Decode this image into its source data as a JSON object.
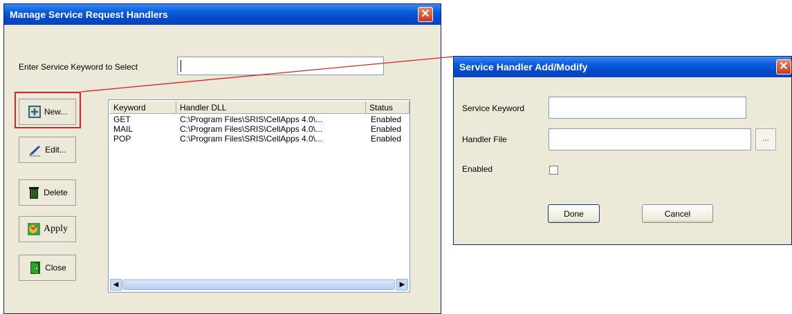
{
  "manage_window": {
    "title": "Manage Service Request Handlers",
    "keyword_label": "Enter Service Keyword to Select",
    "keyword_value": "",
    "buttons": {
      "new_label": "New...",
      "edit_label": "Edit...",
      "delete_label": "Delete",
      "apply_label": "Apply",
      "close_label": "Close"
    },
    "list": {
      "columns": [
        "Keyword",
        "Handler DLL",
        "Status"
      ],
      "rows": [
        {
          "keyword": "GET",
          "dll": "C:\\Program Files\\SRIS\\CellApps 4.0\\...",
          "status": "Enabled"
        },
        {
          "keyword": "MAIL",
          "dll": "C:\\Program Files\\SRIS\\CellApps 4.0\\...",
          "status": "Enabled"
        },
        {
          "keyword": "POP",
          "dll": "C:\\Program Files\\SRIS\\CellApps 4.0\\...",
          "status": "Enabled"
        }
      ]
    }
  },
  "modify_window": {
    "title": "Service Handler Add/Modify",
    "service_keyword_label": "Service Keyword",
    "service_keyword_value": "",
    "handler_file_label": "Handler File",
    "handler_file_value": "",
    "browse_label": "...",
    "enabled_label": "Enabled",
    "enabled_checked": false,
    "done_label": "Done",
    "cancel_label": "Cancel"
  },
  "colors": {
    "titlebar": "#0a5fd8",
    "window_bg": "#ece9d8",
    "callout_red": "#e02020"
  },
  "icons": [
    "close-icon",
    "new-document-icon",
    "edit-pen-icon",
    "trash-icon",
    "apply-hand-icon",
    "door-exit-icon",
    "scroll-left-icon",
    "scroll-right-icon"
  ]
}
